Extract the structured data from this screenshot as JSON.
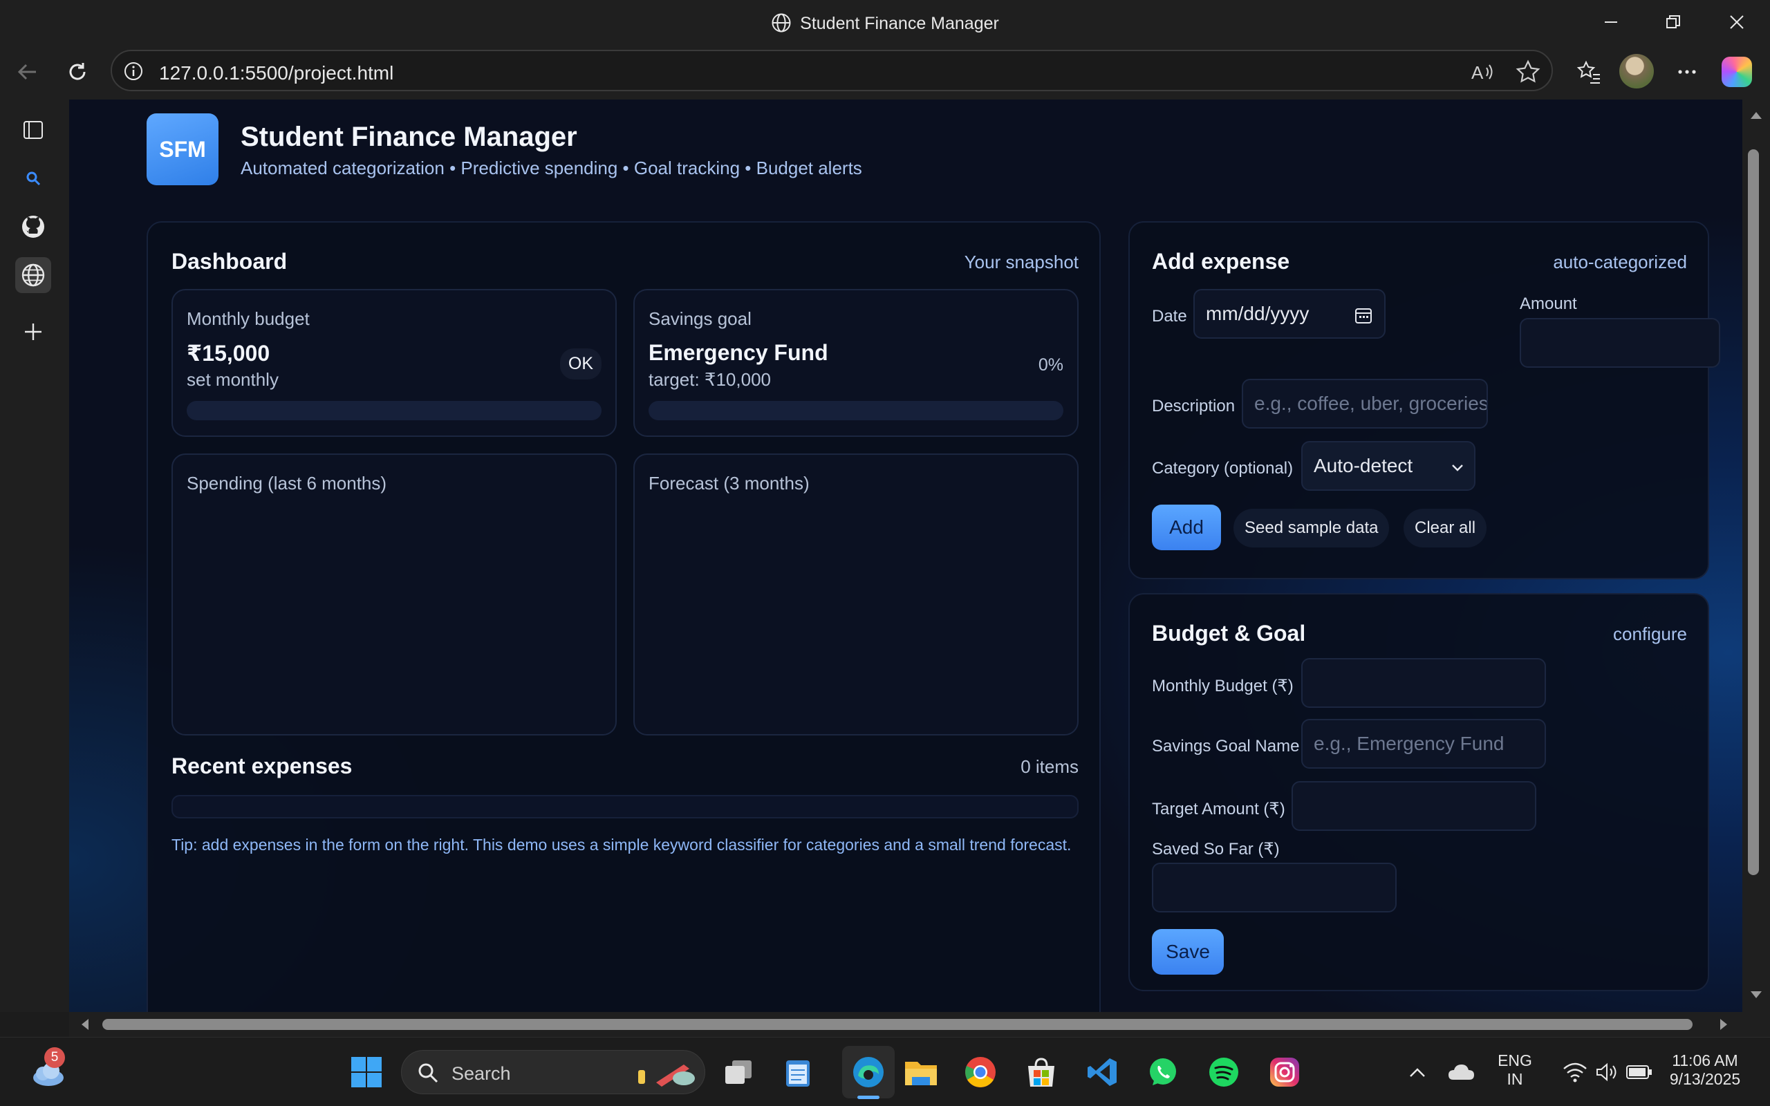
{
  "window": {
    "title": "Student Finance Manager"
  },
  "browser": {
    "url": "127.0.0.1:5500/project.html"
  },
  "app": {
    "logo": "SFM",
    "title": "Student Finance Manager",
    "subtitle": "Automated categorization • Predictive spending • Goal tracking • Budget alerts"
  },
  "dashboard": {
    "title": "Dashboard",
    "hint": "Your snapshot",
    "budget": {
      "label": "Monthly budget",
      "value": "₹15,000",
      "sub": "set monthly",
      "status": "OK",
      "progress": 0
    },
    "goal": {
      "label": "Savings goal",
      "name": "Emergency Fund",
      "target": "target: ₹10,000",
      "percent": "0%",
      "progress": 0
    },
    "spending_title": "Spending (last 6 months)",
    "forecast_title": "Forecast (3 months)",
    "recent_title": "Recent expenses",
    "recent_count": "0 items",
    "tip": "Tip: add expenses in the form on the right. This demo uses a simple keyword classifier for categories and a small trend forecast."
  },
  "add_expense": {
    "title": "Add expense",
    "hint": "auto-categorized",
    "date_label": "Date",
    "date_placeholder": "mm/dd/yyyy",
    "amount_label": "Amount",
    "description_label": "Description",
    "description_placeholder": "e.g., coffee, uber, groceries",
    "category_label": "Category (optional)",
    "category_value": "Auto-detect",
    "add_button": "Add",
    "seed_button": "Seed sample data",
    "clear_button": "Clear all"
  },
  "budget_goal": {
    "title": "Budget & Goal",
    "hint": "configure",
    "monthly_budget_label": "Monthly Budget (₹)",
    "goal_name_label": "Savings Goal Name",
    "goal_name_placeholder": "e.g., Emergency Fund",
    "target_label": "Target Amount (₹)",
    "saved_label": "Saved So Far (₹)",
    "save_button": "Save"
  },
  "taskbar": {
    "weather_badge": "5",
    "search_placeholder": "Search",
    "lang_top": "ENG",
    "lang_bottom": "IN",
    "time": "11:06 AM",
    "date": "9/13/2025"
  },
  "colors": {
    "accent": "#3b82f0",
    "background": "#0a0f1f",
    "panel": "#090e1c"
  }
}
